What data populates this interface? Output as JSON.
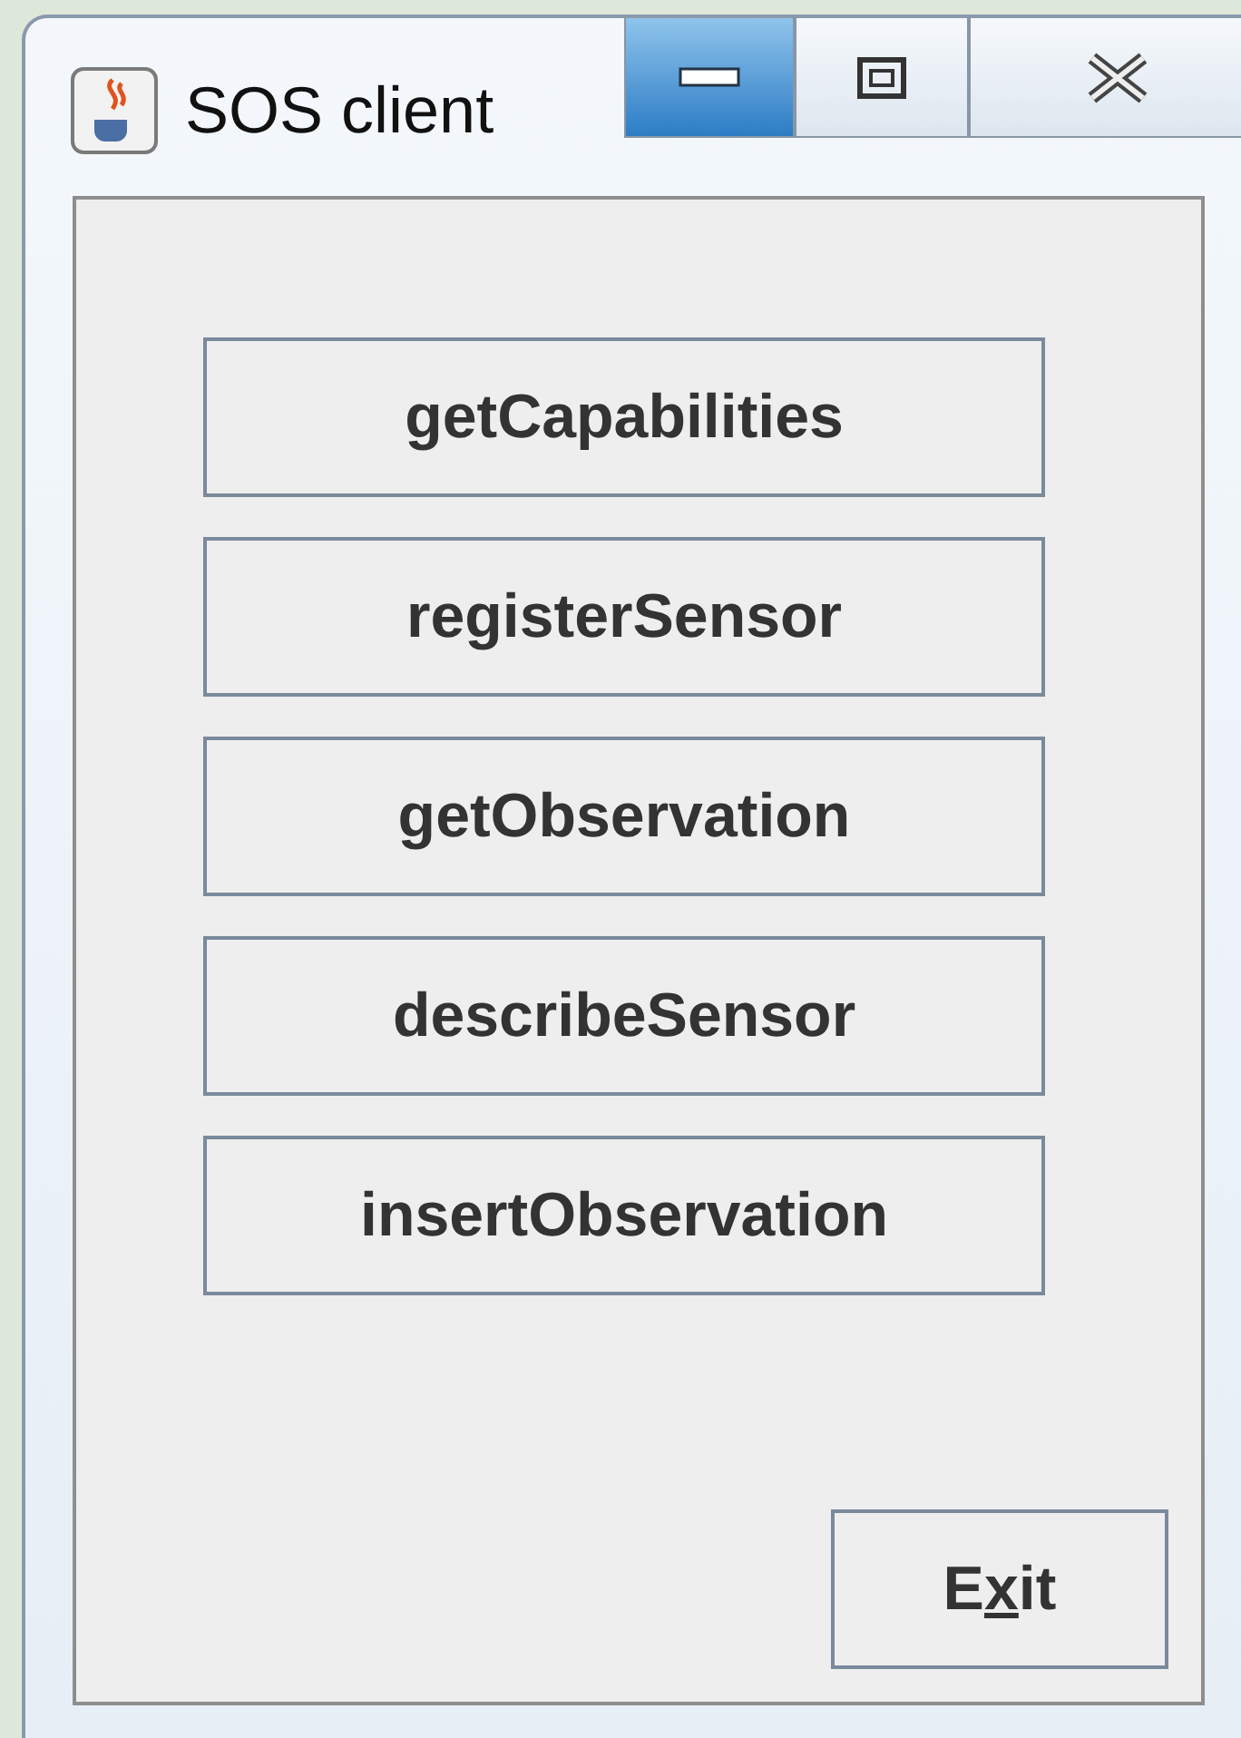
{
  "window": {
    "title": "SOS client"
  },
  "buttons": [
    {
      "label": "getCapabilities"
    },
    {
      "label": "registerSensor"
    },
    {
      "label": "getObservation"
    },
    {
      "label": "describeSensor"
    },
    {
      "label": "insertObservation"
    }
  ],
  "exit_button": {
    "label_before": "E",
    "mnemonic": "x",
    "label_after": "it"
  }
}
